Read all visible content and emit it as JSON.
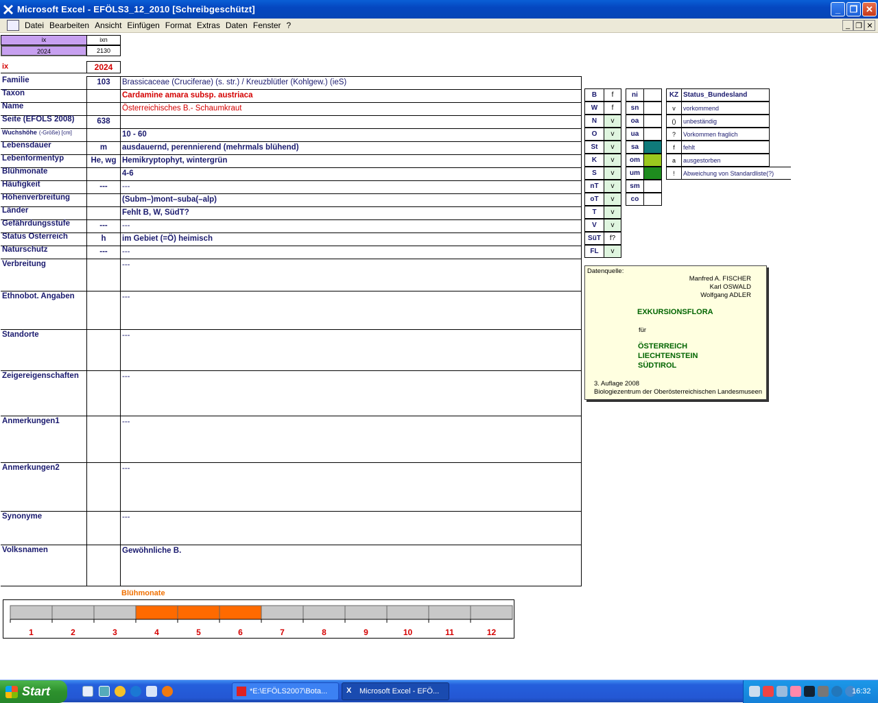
{
  "window": {
    "title": "Microsoft Excel - EFÖLS3_12_2010  [Schreibgeschützt]"
  },
  "menu": [
    "Datei",
    "Bearbeiten",
    "Ansicht",
    "Einfügen",
    "Format",
    "Extras",
    "Daten",
    "Fenster",
    "?"
  ],
  "top": {
    "ix_head": "ix",
    "ixn_head": "ixn",
    "ix_val": "2024",
    "ixn_val": "2130",
    "ix_label": "ix",
    "ix_value": "2024"
  },
  "rows": [
    {
      "label": "Familie",
      "code": "103",
      "value": "Brassicaceae (Cruciferae) (s. str.)  /  Kreuzblütler (Kohlgew.) (ieS)"
    },
    {
      "label": "Taxon",
      "code": "",
      "value": "Cardamine amara subsp. austriaca"
    },
    {
      "label": "Name",
      "code": "",
      "value": "Österreichisches B.- Schaumkraut"
    },
    {
      "label": "Seite (EFÖLS 2008)",
      "code": "638",
      "value": ""
    },
    {
      "label": "Wuchshöhe",
      "label_small": "(-Größe) [cm]",
      "code": "",
      "value": "10 - 60"
    },
    {
      "label": "Lebensdauer",
      "code": "m",
      "value": "ausdauernd, perennierend (mehrmals blühend)"
    },
    {
      "label": "Lebenformentyp",
      "code": "He, wg",
      "value": "Hemikryptophyt, wintergrün"
    },
    {
      "label": "Blühmonate",
      "code": "",
      "value": "4-6"
    },
    {
      "label": "Häufigkeit",
      "code": "---",
      "value": "---"
    },
    {
      "label": "Höhenverbreitung",
      "code": "",
      "value": "(Subm–)mont–suba(–alp)"
    },
    {
      "label": "Länder",
      "code": "",
      "value": "Fehlt B, W, SüdT?"
    },
    {
      "label": "Gefährdungsstufe",
      "code": "---",
      "value": "---"
    },
    {
      "label": "Status Österreich",
      "code": "h",
      "value": "im Gebiet (=Ö) heimisch"
    },
    {
      "label": "Naturschutz",
      "code": "---",
      "value": "---"
    }
  ],
  "big_rows": [
    {
      "label": "Verbreitung",
      "value": "---"
    },
    {
      "label": "Ethnobot. Angaben",
      "value": "---"
    },
    {
      "label": "Standorte",
      "value": "---"
    },
    {
      "label": "Zeigereigenschaften",
      "value": "---"
    },
    {
      "label": "Anmerkungen1",
      "value": "---"
    },
    {
      "label": "Anmerkungen2",
      "value": "---"
    },
    {
      "label": "Synonyme",
      "value": "---"
    },
    {
      "label": "Volksnamen",
      "value": "Gewöhnliche B."
    }
  ],
  "states": [
    {
      "k": "B",
      "v": "f"
    },
    {
      "k": "W",
      "v": "f"
    },
    {
      "k": "N",
      "v": "v"
    },
    {
      "k": "O",
      "v": "v"
    },
    {
      "k": "St",
      "v": "v"
    },
    {
      "k": "K",
      "v": "v"
    },
    {
      "k": "S",
      "v": "v"
    },
    {
      "k": "nT",
      "v": "v"
    },
    {
      "k": "oT",
      "v": "v"
    },
    {
      "k": "T",
      "v": "v"
    },
    {
      "k": "V",
      "v": "v"
    },
    {
      "k": "SüT",
      "v": "f?"
    },
    {
      "k": "FL",
      "v": "v"
    }
  ],
  "zones": [
    {
      "k": "ni",
      "color": ""
    },
    {
      "k": "sn",
      "color": ""
    },
    {
      "k": "oa",
      "color": ""
    },
    {
      "k": "ua",
      "color": ""
    },
    {
      "k": "sa",
      "color": "#0f7a7a"
    },
    {
      "k": "om",
      "color": "#9bc81e"
    },
    {
      "k": "um",
      "color": "#1e8c1e"
    },
    {
      "k": "sm",
      "color": ""
    },
    {
      "k": "co",
      "color": ""
    }
  ],
  "legend": {
    "head_kz": "KZ",
    "head_status": "Status_Bundesland",
    "items": [
      {
        "kz": "v",
        "text": "vorkommend"
      },
      {
        "kz": "()",
        "text": "unbeständig"
      },
      {
        "kz": "?",
        "text": "Vorkommen fraglich"
      },
      {
        "kz": "f",
        "text": "fehlt"
      },
      {
        "kz": "a",
        "text": "ausgestorben"
      },
      {
        "kz": "!",
        "text": "Abweichung von Standardliste(?)"
      }
    ]
  },
  "book": {
    "source": "Datenquelle:",
    "a1": "Manfred A. FISCHER",
    "a2": "Karl OSWALD",
    "a3": "Wolfgang ADLER",
    "title": "EXKURSIONSFLORA",
    "fuer": "für",
    "c1": "ÖSTERREICH",
    "c2": "LIECHTENSTEIN",
    "c3": "SÜDTIROL",
    "edition": "3. Auflage 2008",
    "publisher": "Biologiezentrum der Oberösterreichischen Landesmuseen"
  },
  "chart_data": {
    "type": "bar",
    "title": "Blühmonate",
    "categories": [
      "1",
      "2",
      "3",
      "4",
      "5",
      "6",
      "7",
      "8",
      "9",
      "10",
      "11",
      "12"
    ],
    "values": [
      0,
      0,
      0,
      1,
      1,
      1,
      0,
      0,
      0,
      0,
      0,
      0
    ],
    "colors": {
      "on": "#ff6a00",
      "off": "#c8c8c8"
    }
  },
  "taskbar": {
    "start": "Start",
    "tasks": [
      "*E:\\EFÖLS2007\\Bota...",
      "Microsoft Excel - EFÖ..."
    ],
    "clock": "16:32"
  }
}
